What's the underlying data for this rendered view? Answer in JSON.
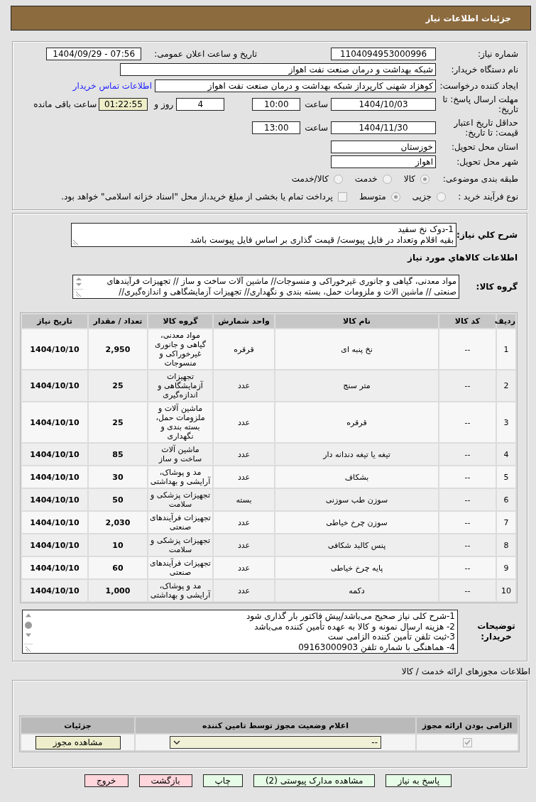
{
  "header": {
    "title": "جزئیات اطلاعات نیاز"
  },
  "details": {
    "need_number": {
      "label": "شماره نیاز:",
      "value": "1104094953000996"
    },
    "announce": {
      "label": "تاریخ و ساعت اعلان عمومی:",
      "value": "1404/09/29 - 07:56"
    },
    "buyer_org": {
      "label": "نام دستگاه خریدار:",
      "value": "شبکه بهداشت و درمان صنعت نفت اهواز"
    },
    "requester": {
      "label": "ایجاد کننده درخواست:",
      "value": "کوهزاد شهنی کارپرداز شبکه بهداشت و درمان صنعت نفت اهواز",
      "link": "اطلاعات تماس خریدار"
    },
    "deadline": {
      "label": "مهلت ارسال پاسخ: تا تاریخ:",
      "date": "1404/10/03",
      "time_label": "ساعت",
      "time": "10:00",
      "days": "4",
      "days_label": "روز و",
      "remaining": "01:22:55",
      "remaining_label": "ساعت باقی مانده"
    },
    "price_validity": {
      "label": "حداقل تاریخ اعتبار قیمت: تا تاریخ:",
      "date": "1404/11/30",
      "time_label": "ساعت",
      "time": "13:00"
    },
    "province": {
      "label": "استان محل تحویل:",
      "value": "خوزستان"
    },
    "city": {
      "label": "شهر محل تحویل:",
      "value": "اهواز"
    },
    "category": {
      "label": "طبقه بندی موضوعی:",
      "options": [
        {
          "label": "کالا",
          "selected": true
        },
        {
          "label": "خدمت",
          "selected": false
        },
        {
          "label": "کالا/خدمت",
          "selected": false
        }
      ]
    },
    "process": {
      "label": "نوع فرآیند خرید :",
      "options": [
        {
          "label": "جزیی",
          "selected": false
        },
        {
          "label": "متوسط",
          "selected": true
        }
      ],
      "treasury": {
        "label": "پرداخت تمام یا بخشی از مبلغ خرید،از محل \"اسناد خزانه اسلامی\" خواهد بود.",
        "checked": false
      }
    }
  },
  "description": {
    "label": "شرح کلي نیاز:",
    "lines": [
      "1-دوک نخ سفید",
      "بقیه اقلام وتعداد در فایل پیوست/ قیمت گذاری بر اساس فایل پیوست باشد"
    ]
  },
  "goods": {
    "title": "اطلاعات کالاهاي مورد نیاز",
    "group_label": "گروه کالا:",
    "group_value": "مواد معدنی، گیاهی و جانوری غیرخوراکی و منسوجات// ماشین آلات ساخت و ساز // تجهیزات فرآیندهای صنعتی // ماشین الات و ملزومات حمل، بسته بندی و نگهداری// تجهیزات آزمایشگاهی و اندازه‌گیری//",
    "table": {
      "columns": [
        "ردیف",
        "کد کالا",
        "نام کالا",
        "واحد شمارش",
        "گروه کالا",
        "تعداد / مقدار",
        "تاریخ نیاز"
      ],
      "rows": [
        {
          "row": "1",
          "code": "--",
          "name": "نخ پنبه ای",
          "unit": "قرقره",
          "group": "مواد معدنی، گیاهی و جانوری غیرخوراکی و منسوجات",
          "quantity": "2,950",
          "need_date": "1404/10/10"
        },
        {
          "row": "2",
          "code": "--",
          "name": "متر سنج",
          "unit": "عدد",
          "group": "تجهیزات آزمایشگاهی و اندازه‌گیری",
          "quantity": "25",
          "need_date": "1404/10/10"
        },
        {
          "row": "3",
          "code": "--",
          "name": "قرقره",
          "unit": "عدد",
          "group": "ماشین آلات و ملزومات حمل، بسته بندی و نگهداری",
          "quantity": "25",
          "need_date": "1404/10/10"
        },
        {
          "row": "4",
          "code": "--",
          "name": "تیغه یا تیغه دندانه دار",
          "unit": "عدد",
          "group": "ماشین آلات ساخت و ساز",
          "quantity": "85",
          "need_date": "1404/10/10"
        },
        {
          "row": "5",
          "code": "--",
          "name": "بشکاف",
          "unit": "عدد",
          "group": "مد و پوشاک، آرایشی و بهداشتی",
          "quantity": "30",
          "need_date": "1404/10/10"
        },
        {
          "row": "6",
          "code": "--",
          "name": "سوزن طب سوزنی",
          "unit": "بسته",
          "group": "تجهیزات پزشکی و سلامت",
          "quantity": "50",
          "need_date": "1404/10/10"
        },
        {
          "row": "7",
          "code": "--",
          "name": "سوزن چرخ خیاطی",
          "unit": "عدد",
          "group": "تجهیزات فرآیندهای صنعتی",
          "quantity": "2,030",
          "need_date": "1404/10/10"
        },
        {
          "row": "8",
          "code": "--",
          "name": "پنس کالبد شکافی",
          "unit": "عدد",
          "group": "تجهیزات پزشکی و سلامت",
          "quantity": "10",
          "need_date": "1404/10/10"
        },
        {
          "row": "9",
          "code": "--",
          "name": "پایه چرخ خیاطی",
          "unit": "عدد",
          "group": "تجهیزات فرآیندهای صنعتی",
          "quantity": "60",
          "need_date": "1404/10/10"
        },
        {
          "row": "10",
          "code": "--",
          "name": "دکمه",
          "unit": "عدد",
          "group": "مد و پوشاک، آرایشی و بهداشتی",
          "quantity": "1,000",
          "need_date": "1404/10/10"
        }
      ]
    }
  },
  "buyer_notes": {
    "label": "توضیحات خریدار:",
    "lines": [
      "1-شرح کلی نیاز صحیح می‌باشد/پیش فاکتور بار گذاری شود",
      "2- هزینه ارسال نمونه و کالا به عهده تأمین کننده می‌باشد",
      "3-ثبت تلفن تأمین کننده الزامی ست",
      "4- هماهنگی با شماره تلفن 09163000903"
    ]
  },
  "licenses": {
    "title": "اطلاعات مجوزهای ارائه خدمت / کالا",
    "columns": [
      "الزامی بودن ارائه مجوز",
      "اعلام وضعیت مجوز توسط تامین کننده",
      "جزئیات"
    ],
    "rows": [
      {
        "required": true,
        "status": "--",
        "details_button": "مشاهده مجوز"
      }
    ]
  },
  "buttons": [
    {
      "label": "پاسخ به نیاز",
      "kind": "normal"
    },
    {
      "label": "مشاهده مدارک پیوستی (2)",
      "kind": "normal"
    },
    {
      "label": "چاپ",
      "kind": "normal"
    },
    {
      "label": "بازگشت",
      "kind": "exit"
    },
    {
      "label": "خروج",
      "kind": "exit"
    }
  ]
}
